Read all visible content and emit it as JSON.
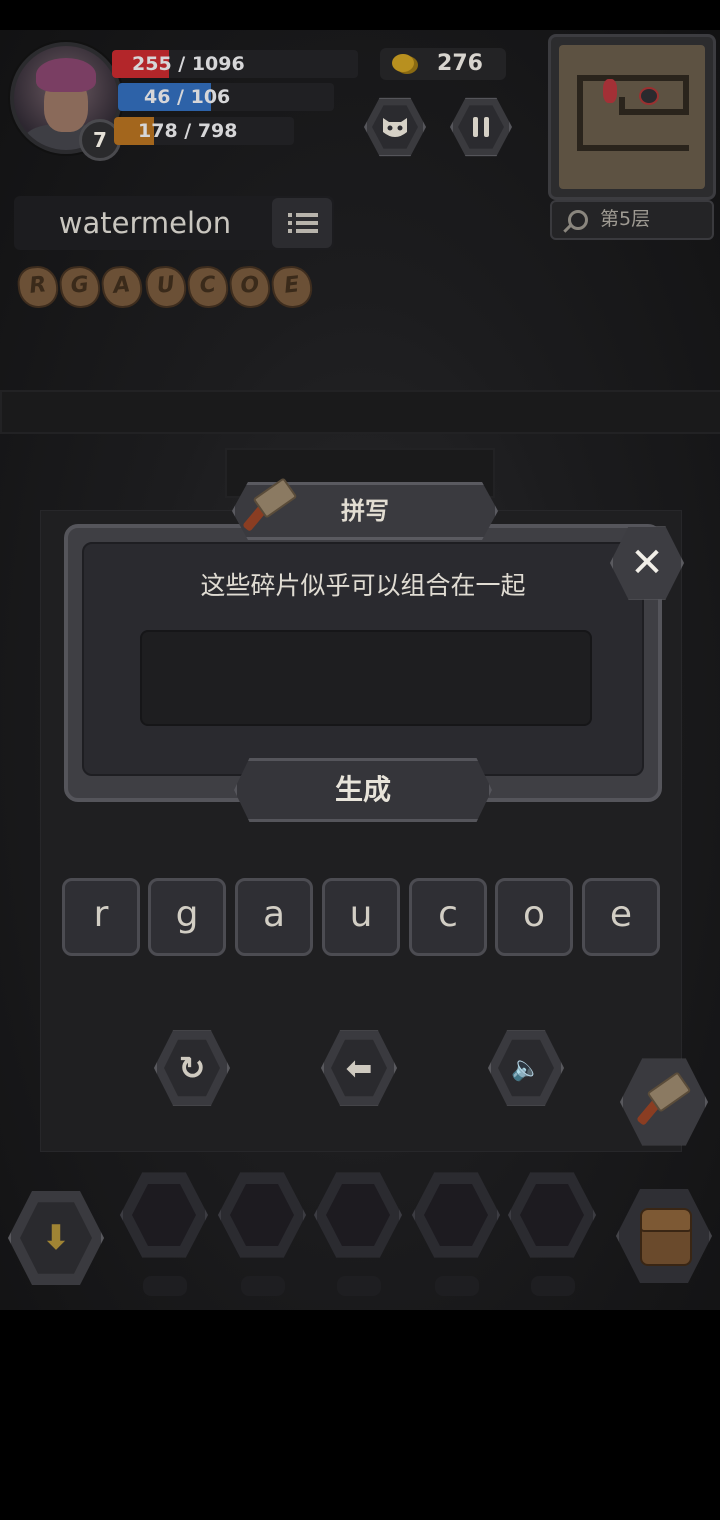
{
  "hud": {
    "level": "7",
    "hp": "255 / 1096",
    "mp": "46 / 106",
    "xp": "178 / 798",
    "hp_fill": 0.23,
    "mp_fill": 0.43,
    "xp_fill": 0.22,
    "gold": "276",
    "floor": "第5层",
    "colors": {
      "hp": "#b3262a",
      "mp": "#2d62a8",
      "xp": "#a3661d"
    }
  },
  "spelling": {
    "target_word": "watermelon",
    "shards": [
      "R",
      "G",
      "A",
      "U",
      "C",
      "O",
      "E"
    ]
  },
  "dialog": {
    "title": "拼写",
    "message": "这些碎片似乎可以组合在一起",
    "input_value": "",
    "generate_label": "生成",
    "close_glyph": "✕"
  },
  "letters": [
    "r",
    "g",
    "a",
    "u",
    "c",
    "o",
    "e"
  ],
  "controls": {
    "reset_glyph": "↻",
    "back_glyph": "⬅",
    "sound_glyph": "🔈",
    "down_glyph": "⬇"
  },
  "icons": {
    "pet": "pet-face-icon",
    "pause": "pause-icon",
    "search": "search-icon",
    "list": "list-icon",
    "hammer": "hammer-icon",
    "bag": "backpack-icon"
  }
}
